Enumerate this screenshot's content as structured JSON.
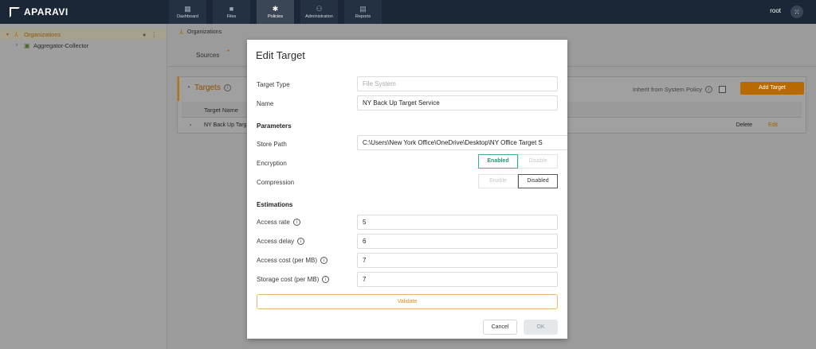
{
  "app": {
    "logo_text": "APARAVI",
    "user": "root",
    "apps_icon": "grid-icon"
  },
  "nav": [
    {
      "label": "Dashboard",
      "icon": "dashboard-icon"
    },
    {
      "label": "Files",
      "icon": "folder-icon"
    },
    {
      "label": "Policies",
      "icon": "gear-icon"
    },
    {
      "label": "Administration",
      "icon": "users-icon"
    },
    {
      "label": "Reports",
      "icon": "report-icon"
    }
  ],
  "sidebar": {
    "items": [
      {
        "label": "Organizations",
        "icon": "organization-icon",
        "selected": true
      },
      {
        "label": "Aggregator-Collector",
        "icon": "server-icon",
        "selected": false
      }
    ]
  },
  "main": {
    "breadcrumb": "Organizations",
    "tab": "Sources",
    "panel_title": "Targets",
    "inherit_label": "Inherit from System Policy",
    "add_button": "Add Target",
    "column_header": "Target Name",
    "row": {
      "name": "NY Back Up Targ",
      "delete": "Delete",
      "edit": "Edit"
    }
  },
  "modal": {
    "title": "Edit Target",
    "target_type_label": "Target Type",
    "target_type_value": "File System",
    "name_label": "Name",
    "name_value": "NY Back Up Target Service",
    "parameters_heading": "Parameters",
    "store_path_label": "Store Path",
    "store_path_value": "C:\\Users\\New York Office\\OneDrive\\Desktop\\NY Office Target S",
    "encryption_label": "Encryption",
    "encryption_enabled": "Enabled",
    "encryption_disable": "Disable",
    "compression_label": "Compression",
    "compression_enable": "Enable",
    "compression_disabled": "Disabled",
    "estimations_heading": "Estimations",
    "access_rate_label": "Access rate",
    "access_rate_value": "5",
    "access_delay_label": "Access delay",
    "access_delay_value": "6",
    "access_cost_label": "Access cost (per MB)",
    "access_cost_value": "7",
    "storage_cost_label": "Storage cost (per MB)",
    "storage_cost_value": "7",
    "validate_button": "Validate",
    "cancel_button": "Cancel",
    "ok_button": "OK"
  },
  "colors": {
    "accent": "#e08a1e",
    "enabled_green": "#1f9a6e",
    "topbar": "#1b2736"
  }
}
